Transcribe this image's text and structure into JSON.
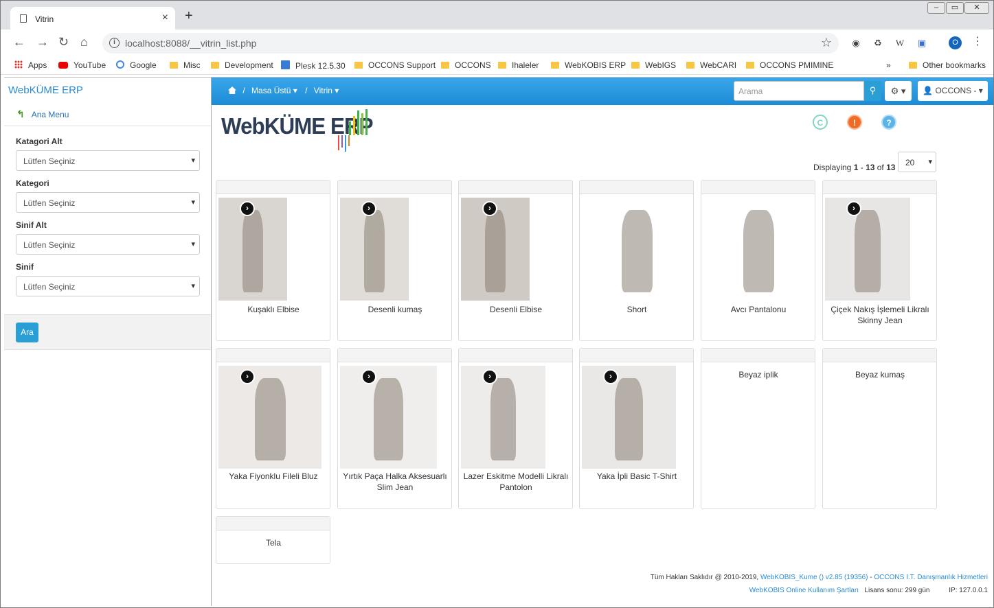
{
  "browser": {
    "tab_title": "Vitrin",
    "new_tab": "+",
    "url_host": "localhost",
    "url_rest": ":8088/__vitrin_list.php",
    "profile_initial": "O",
    "bookmarks": [
      "Apps",
      "YouTube",
      "Google",
      "Misc",
      "Development",
      "Plesk 12.5.30",
      "OCCONS Support",
      "OCCONS",
      "Ihaleler",
      "WebKOBIS ERP",
      "WebIGS",
      "WebCARI",
      "OCCONS PMIMINE"
    ],
    "other_bookmarks": "Other bookmarks",
    "overflow": "»"
  },
  "sidebar": {
    "brand": "WebKÜME ERP",
    "ana_menu": "Ana Menu",
    "filters": [
      {
        "label": "Katagori Alt",
        "value": "Lütfen Seçiniz"
      },
      {
        "label": "Kategori",
        "value": "Lütfen Seçiniz"
      },
      {
        "label": "Sinif Alt",
        "value": "Lütfen Seçiniz"
      },
      {
        "label": "Sinif",
        "value": "Lütfen Seçiniz"
      }
    ],
    "search_button": "Ara"
  },
  "topbar": {
    "crumb_sep": "/",
    "crumb_1": "Masa Üstü",
    "crumb_2": "Vitrin",
    "search_placeholder": "Arama",
    "user": "OCCONS -"
  },
  "logo_text": "WebKÜME ERP",
  "status_icons": [
    {
      "name": "c-icon",
      "glyph": "C",
      "color": "#7fd6c4"
    },
    {
      "name": "alert-icon",
      "glyph": "!",
      "color": "#f26b22"
    },
    {
      "name": "help-icon",
      "glyph": "?",
      "color": "#5ab4e8"
    }
  ],
  "pagination": {
    "prefix": "Displaying ",
    "from": "1",
    "dash": " - ",
    "to": "13",
    "of": " of ",
    "total": "13",
    "page_size": "20"
  },
  "products": [
    {
      "name": "Kuşaklı Elbise",
      "has_image": true,
      "img_color": "#d9d6d2"
    },
    {
      "name": "Desenli kumaş",
      "has_image": true,
      "img_color": "#e0ddd8"
    },
    {
      "name": "Desenli Elbise",
      "has_image": true,
      "img_color": "#cfcac4"
    },
    {
      "name": "Short",
      "has_image": true,
      "img_color": "#ffffff"
    },
    {
      "name": "Avcı Pantalonu",
      "has_image": true,
      "img_color": "#ffffff"
    },
    {
      "name": "Çiçek Nakış İşlemeli Likralı Skinny Jean",
      "has_image": true,
      "img_color": "#e8e6e4"
    },
    {
      "name": "Yaka Fiyonklu Fileli Bluz",
      "has_image": true,
      "img_color": "#ece9e6"
    },
    {
      "name": "Yırtık Paça Halka Aksesuarlı Slim Jean",
      "has_image": true,
      "img_color": "#f0eeec"
    },
    {
      "name": "Lazer Eskitme Modelli Likralı Pantolon",
      "has_image": true,
      "img_color": "#eeeceb"
    },
    {
      "name": "Yaka İpli Basic T-Shirt",
      "has_image": true,
      "img_color": "#eae8e6"
    },
    {
      "name": "Beyaz iplik",
      "has_image": false
    },
    {
      "name": "Beyaz kumaş",
      "has_image": false
    },
    {
      "name": "Tela",
      "has_image": false
    }
  ],
  "footer": {
    "rights": "Tüm Hakları Saklıdır @ 2010-2019, ",
    "product_link": "WebKOBIS_Kume () v2.85 (19356)",
    "dash": " - ",
    "company_link": "OCCONS I.T. Danışmanlık Hizmetleri",
    "terms_link": "WebKOBIS Online Kullanım Şartları",
    "license": "Lisans sonu: 299 gün",
    "ip": "IP: 127.0.0.1"
  }
}
